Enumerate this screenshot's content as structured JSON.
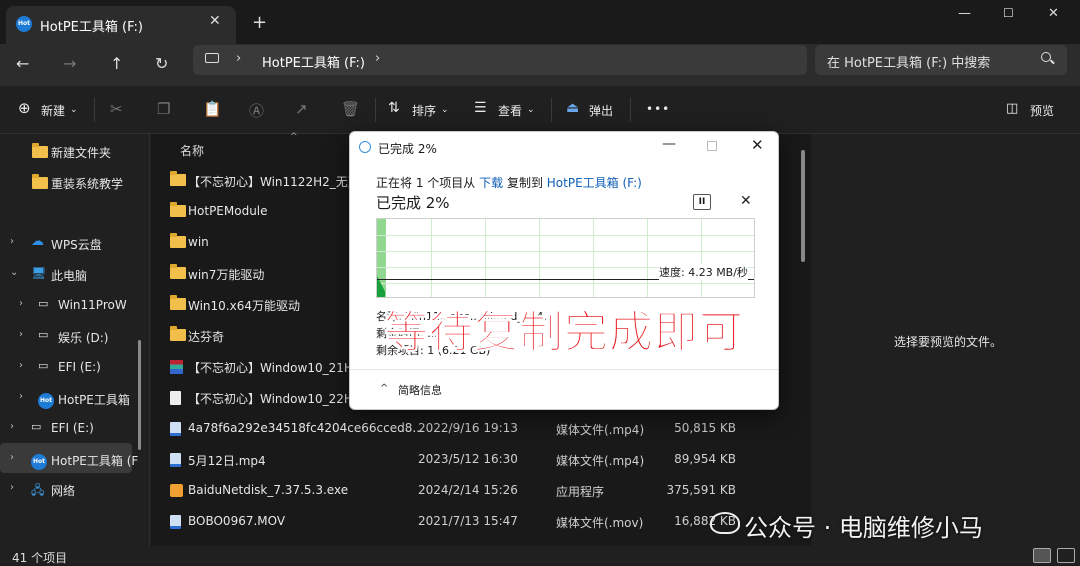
{
  "window": {
    "tab_title": "HotPE工具箱 (F:)",
    "tab_icon_text": "Hot",
    "new_tab": "+",
    "tab_close": "✕"
  },
  "nav": {
    "path": "HotPE工具箱 (F:)",
    "search_placeholder": "在 HotPE工具箱 (F:) 中搜索"
  },
  "toolbar": {
    "new_label": "新建",
    "sort_label": "排序",
    "view_label": "查看",
    "eject_label": "弹出",
    "more": "•••",
    "preview_label": "预览"
  },
  "sidebar": {
    "items": [
      {
        "label": "新建文件夹",
        "icon": "folder-icon"
      },
      {
        "label": "重装系统教学",
        "icon": "folder-icon"
      },
      {
        "label": "WPS云盘",
        "icon": "cloud-icon"
      },
      {
        "label": "此电脑",
        "icon": "pc-icon"
      },
      {
        "label": "Win11ProW",
        "icon": "drive-icon"
      },
      {
        "label": "娱乐 (D:)",
        "icon": "drive-icon"
      },
      {
        "label": "EFI (E:)",
        "icon": "drive-icon"
      },
      {
        "label": "HotPE工具箱",
        "icon": "hotpe-icon"
      },
      {
        "label": "EFI (E:)",
        "icon": "drive-icon"
      },
      {
        "label": "HotPE工具箱 (F",
        "icon": "hotpe-icon"
      },
      {
        "label": "网络",
        "icon": "network-icon"
      }
    ]
  },
  "filelist": {
    "column_name": "名称",
    "rows": [
      {
        "name": "【不忘初心】Win1122H2_无更",
        "date": "",
        "type": "",
        "size": "",
        "icon": "folder"
      },
      {
        "name": "HotPEModule",
        "date": "",
        "type": "",
        "size": "",
        "icon": "folder"
      },
      {
        "name": "win",
        "date": "",
        "type": "",
        "size": "",
        "icon": "folder"
      },
      {
        "name": "win7万能驱动",
        "date": "",
        "type": "",
        "size": "",
        "icon": "folder"
      },
      {
        "name": "Win10.x64万能驱动",
        "date": "",
        "type": "",
        "size": "",
        "icon": "folder"
      },
      {
        "name": "达芬奇",
        "date": "",
        "type": "",
        "size": "",
        "icon": "folder"
      },
      {
        "name": "【不忘初心】Window10_21H2",
        "date": "",
        "type": "",
        "size": "",
        "icon": "rar"
      },
      {
        "name": "【不忘初心】Window10_22H2",
        "date": "",
        "type": "",
        "size": "",
        "icon": "doc"
      },
      {
        "name": "4a78f6a292e34518fc4204ce66cced8...",
        "date": "2022/9/16 19:13",
        "type": "媒体文件(.mp4)",
        "size": "50,815 KB",
        "icon": "media"
      },
      {
        "name": "5月12日.mp4",
        "date": "2023/5/12 16:30",
        "type": "媒体文件(.mp4)",
        "size": "89,954 KB",
        "icon": "media"
      },
      {
        "name": "BaiduNetdisk_7.37.5.3.exe",
        "date": "2024/2/14 15:26",
        "type": "应用程序",
        "size": "375,591 KB",
        "icon": "exe"
      },
      {
        "name": "BOBO0967.MOV",
        "date": "2021/7/13 15:47",
        "type": "媒体文件(.mov)",
        "size": "16,882 KB",
        "icon": "media"
      }
    ]
  },
  "preview": {
    "empty_text": "选择要预览的文件。"
  },
  "status": {
    "count": "41 个项目"
  },
  "dialog": {
    "title": "已完成 2%",
    "line_prefix": "正在将 1 个项目从",
    "source": "下载",
    "line_middle": "复制到",
    "destination": "HotPE工具箱 (F:)",
    "percent_text": "已完成 2%",
    "progress_fraction": 0.02,
    "speed": "速度: 4.23 MB/秒",
    "name_row": "名称: Win11...nes...all...ed_x64...",
    "remaining_time": "剩余时间: ...",
    "remaining_items": "剩余项目: 1 (6.21 GB)",
    "brief": "简略信息"
  },
  "overlay": {
    "caption": "等待复制完成即可",
    "watermark": "公众号 · 电脑维修小马"
  },
  "colors": {
    "accent": "#0f5fb8",
    "caption_red": "#e8161c",
    "graph_green": "#17a03b"
  }
}
